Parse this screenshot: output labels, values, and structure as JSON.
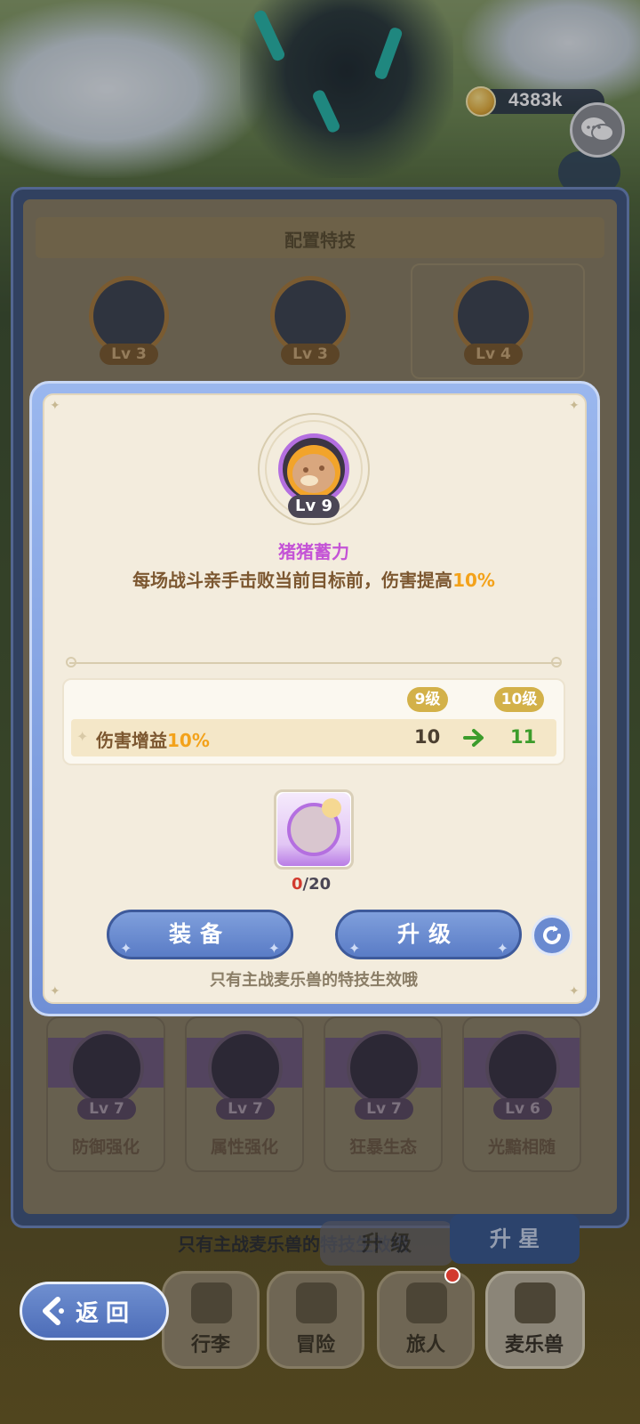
{
  "currency": {
    "value": "4383k",
    "icon": "coin-icon"
  },
  "chat": {
    "icon": "chat-bubbles-icon"
  },
  "back_panel": {
    "title": "配置特技",
    "slots": [
      {
        "level": "Lv 3"
      },
      {
        "level": "Lv 3"
      },
      {
        "level": "Lv 4"
      }
    ],
    "skills": [
      {
        "level": "Lv 7",
        "name": "防御强化"
      },
      {
        "level": "Lv 7",
        "name": "属性强化"
      },
      {
        "level": "Lv 7",
        "name": "狂暴生态"
      },
      {
        "level": "Lv 6",
        "name": "光黯相随"
      }
    ],
    "footer_hint": "只有主战麦乐兽的特技生效哦",
    "upgrade_label": "升 级",
    "star_label": "升 星"
  },
  "modal": {
    "portrait_level": "Lv 9",
    "skill_name": "猪猪蓄力",
    "desc_prefix": "每场战斗亲手击败当前目标前，伤害提高",
    "desc_value": "10%",
    "current_level_label": "9级",
    "next_level_label": "10级",
    "stat_label_prefix": "伤害增益",
    "stat_label_value": "10%",
    "stat_current": "10",
    "stat_next": "11",
    "item_owned": "0",
    "item_required": "/20",
    "equip_label": "装备",
    "upgrade_label": "升级",
    "hint": "只有主战麦乐兽的特技生效哦"
  },
  "nav": {
    "back_label": "返回",
    "items": [
      {
        "label": "行李"
      },
      {
        "label": "冒险"
      },
      {
        "label": "旅人"
      },
      {
        "label": "麦乐兽"
      }
    ]
  }
}
